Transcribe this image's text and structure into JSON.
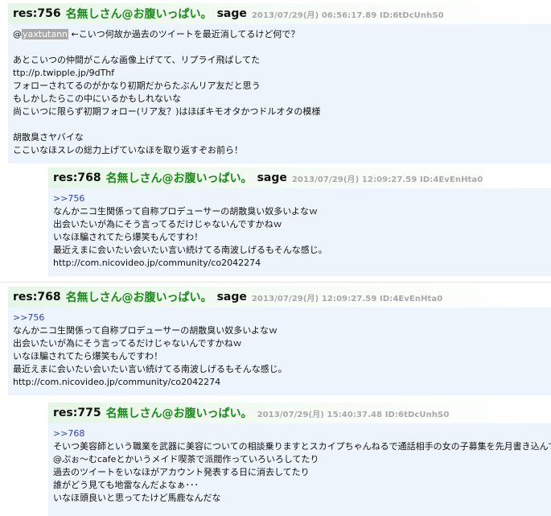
{
  "posts": [
    {
      "resno": "res:756",
      "name": "名無しさん@お腹いっぱい。",
      "mail": "sage",
      "meta": "2013/07/29(月) 06:56:17.89 ID:6tDcUnhS0",
      "lines": [
        {
          "pre": "@",
          "user": "yaxtutann",
          "post": " ←こいつ何故か過去のツイートを最近消してるけど何で？"
        },
        {
          "text": ""
        },
        {
          "text": "あとこいつの仲間がこんな画像上げてて、リプライ飛ばしてた"
        },
        {
          "text": "ttp://p.twipple.jp/9dThf"
        },
        {
          "text": "フォローされてるのがかなり初期だからたぶんリア友だと思う"
        },
        {
          "text": "もしかしたらこの中にいるかもしれないな"
        },
        {
          "text": "尚こいつに限らず初期フォロー(リア友？)はほぼキモオタかつドルオタの模様"
        },
        {
          "text": ""
        },
        {
          "text": "胡散臭さヤバイな"
        },
        {
          "text": "ここいなほスレの総力上げていなほを取り返すぞお前ら！"
        }
      ]
    },
    {
      "resno": "res:768",
      "name": "名無しさん@お腹いっぱい。",
      "mail": "sage",
      "meta": "2013/07/29(月) 12:09:27.59 ID:4EvEnHta0",
      "lines": [
        {
          "text": ">>756",
          "anchor": true
        },
        {
          "text": "なんかニコ生関係って自称プロデューサーの胡散臭い奴多いよなｗ"
        },
        {
          "text": "出会いたいが為にそう言ってるだけじゃないんですかねｗ"
        },
        {
          "text": "いなほ騙されてたら爆笑もんですわ！"
        },
        {
          "text": "最近えまに会いたい会いたい言い続けてる南波しげるもそんな感じ。"
        },
        {
          "text": "http://com.nicovideo.jp/community/co2042274"
        }
      ]
    },
    {
      "resno": "res:768",
      "name": "名無しさん@お腹いっぱい。",
      "mail": "sage",
      "meta": "2013/07/29(月) 12:09:27.59 ID:4EvEnHta0",
      "lines": [
        {
          "text": ">>756",
          "anchor": true
        },
        {
          "text": "なんかニコ生関係って自称プロデューサーの胡散臭い奴多いよなｗ"
        },
        {
          "text": "出会いたいが為にそう言ってるだけじゃないんですかねｗ"
        },
        {
          "text": "いなほ騙されてたら爆笑もんですわ！"
        },
        {
          "text": "最近えまに会いたい会いたい言い続けてる南波しげるもそんな感じ。"
        },
        {
          "text": "http://com.nicovideo.jp/community/co2042274"
        }
      ]
    },
    {
      "resno": "res:775",
      "name": "名無しさん@お腹いっぱい。",
      "mail": "",
      "meta": "2013/07/29(月) 15:40:37.48 ID:6tDcUnhS0",
      "lines": [
        {
          "text": ">>768",
          "anchor": true
        },
        {
          "text": "そいつ美容師という職業を武器に美容についての相談乗りますとスカイプちゃんねるで通話相手の女の子募集を先月書き込んでたり"
        },
        {
          "text": "@ぷぉ～むcafeとかいうメイド喫茶で派閥作っていろいろしてたり"
        },
        {
          "text": "過去のツイートをいなほがアカウント発表する日に消去してたり"
        },
        {
          "text": "誰がどう見ても地雷なんだよなぁ･･･"
        },
        {
          "text": "いなほ頭良いと思ってたけど馬鹿なんだな"
        }
      ]
    }
  ]
}
